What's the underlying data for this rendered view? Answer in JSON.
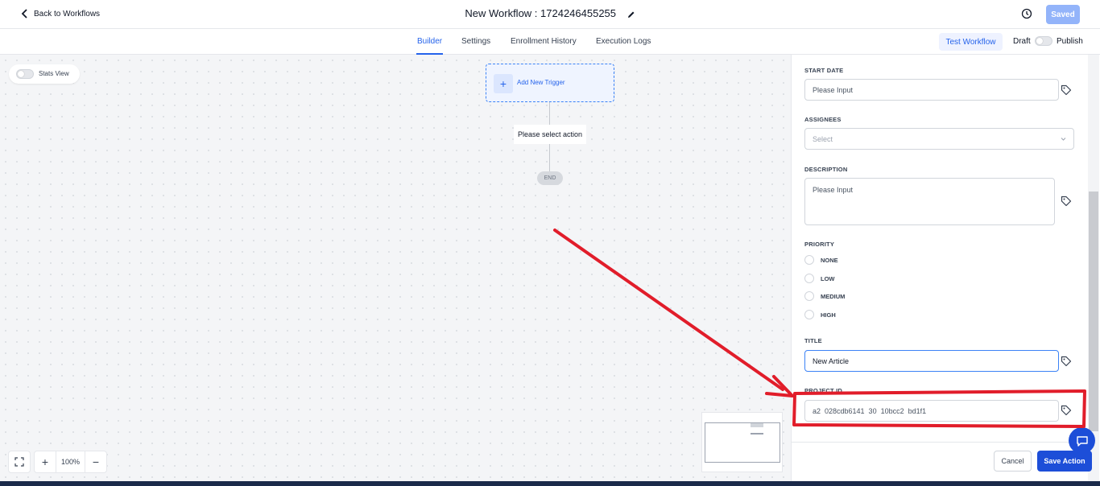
{
  "header": {
    "back_label": "Back to Workflows",
    "workflow_title": "New Workflow : 1724246455255",
    "saved_label": "Saved"
  },
  "tabs": [
    {
      "label": "Builder",
      "active": true
    },
    {
      "label": "Settings"
    },
    {
      "label": "Enrollment History"
    },
    {
      "label": "Execution Logs"
    }
  ],
  "tabbar": {
    "test_label": "Test Workflow",
    "draft_label": "Draft",
    "publish_label": "Publish"
  },
  "canvas": {
    "stats_label": "Stats View",
    "trigger_label": "Add New Trigger",
    "action_label": "Please select action",
    "end_label": "END",
    "zoom": "100%"
  },
  "panel": {
    "start_date": {
      "label": "START DATE",
      "placeholder": "Please Input"
    },
    "assignees": {
      "label": "ASSIGNEES",
      "placeholder": "Select"
    },
    "description": {
      "label": "DESCRIPTION",
      "placeholder": "Please Input"
    },
    "priority": {
      "label": "PRIORITY",
      "options": [
        "NONE",
        "LOW",
        "MEDIUM",
        "HIGH"
      ]
    },
    "title": {
      "label": "TITLE",
      "value": "New Article"
    },
    "project_id": {
      "label": "PROJECT ID",
      "value": "a2  028cdb6141  30  10bcc2  bd1f1"
    },
    "cancel_label": "Cancel",
    "save_label": "Save Action"
  },
  "colors": {
    "accent": "#2563eb",
    "save_button": "#1d4ed8",
    "annotation": "#e11d2a"
  }
}
